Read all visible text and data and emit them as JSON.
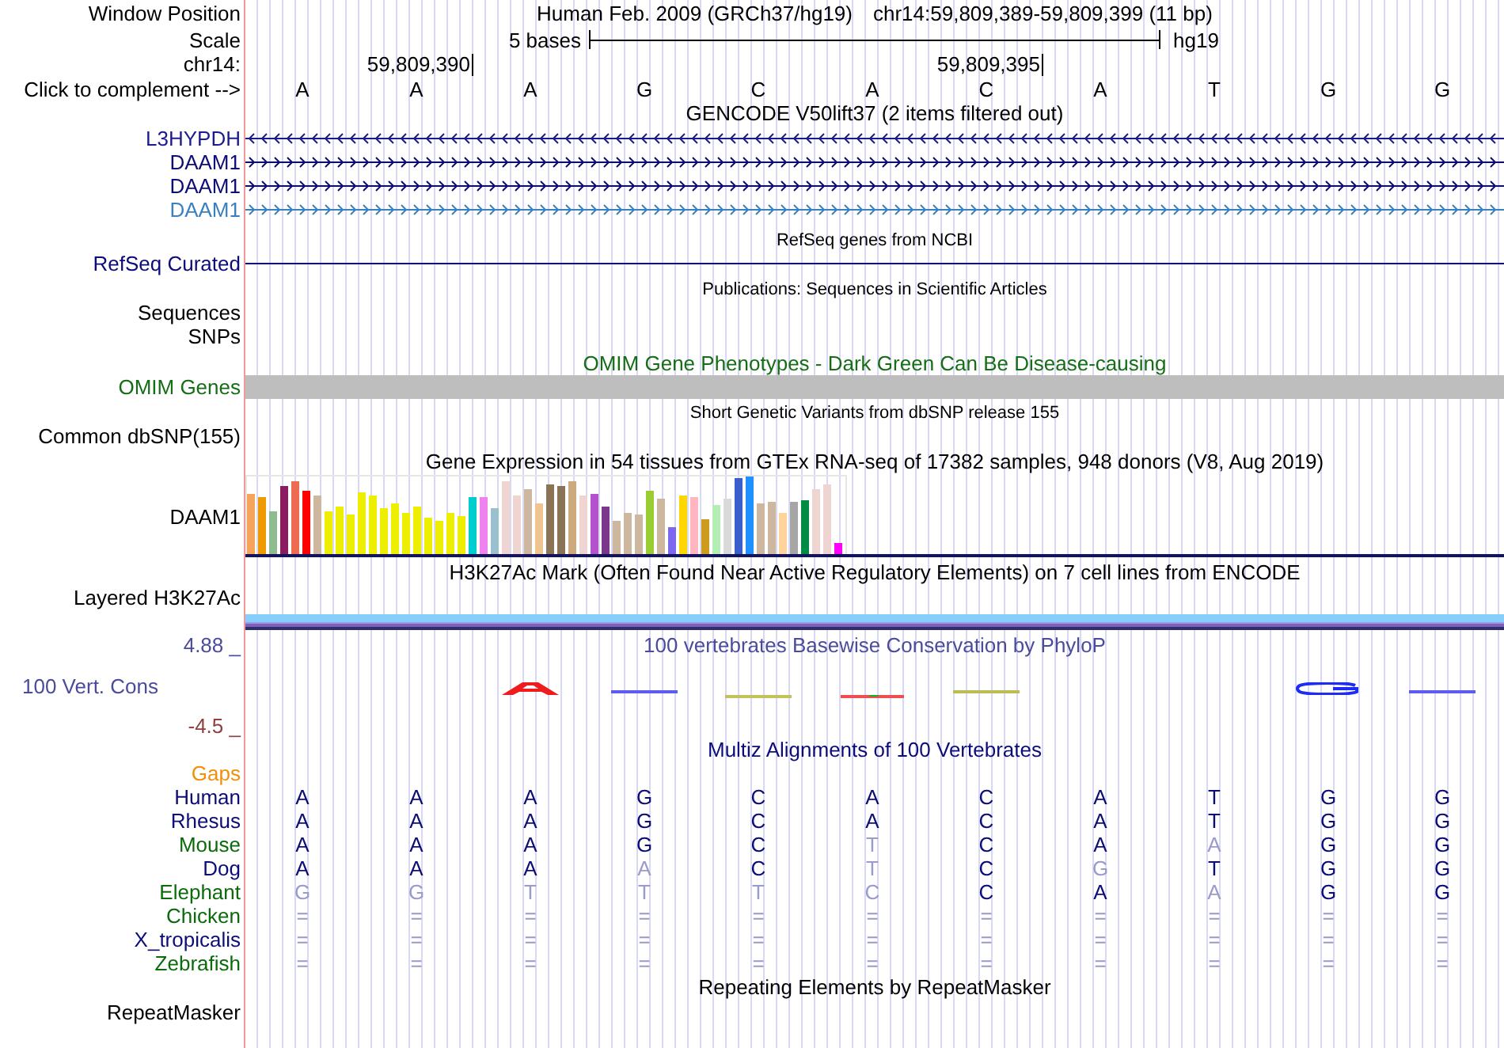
{
  "ruler": {
    "window_label": "Window Position",
    "assembly": "Human Feb. 2009 (GRCh37/hg19)",
    "position": "chr14:59,809,389-59,809,399 (11 bp)",
    "scale_label": "Scale",
    "scale_length": "5 bases",
    "scale_db": "hg19",
    "chrom_label": "chr14:",
    "complement_label": "Click to complement -->",
    "bases": [
      {
        "letter": "A"
      },
      {
        "letter": "A",
        "coordinate": "59,809,390"
      },
      {
        "letter": "A"
      },
      {
        "letter": "G"
      },
      {
        "letter": "C"
      },
      {
        "letter": "A"
      },
      {
        "letter": "C",
        "coordinate": "59,809,395"
      },
      {
        "letter": "A"
      },
      {
        "letter": "T"
      },
      {
        "letter": "G"
      },
      {
        "letter": "G"
      }
    ]
  },
  "tracks": [
    {
      "kind": "genes",
      "title": "GENCODE V50lift37 (2 items filtered out)",
      "color": "#000000",
      "items": [
        {
          "name": "L3HYPDH",
          "reverse_strand": true,
          "color": "#1b1b8f"
        },
        {
          "name": "DAAM1",
          "reverse_strand": false,
          "color": "#0c0c78"
        },
        {
          "name": "DAAM1",
          "reverse_strand": false,
          "color": "#0c0c78"
        },
        {
          "name": "DAAM1",
          "reverse_strand": false,
          "color": "#3a80c0"
        }
      ]
    },
    {
      "kind": "refseq",
      "title": "RefSeq genes from NCBI",
      "label": "RefSeq Curated",
      "color": "#0c0c78"
    },
    {
      "kind": "publications",
      "title": "Publications: Sequences in Scientific Articles",
      "labels": [
        "Sequences",
        "SNPs"
      ],
      "color": "#000000"
    },
    {
      "kind": "omim",
      "title": "OMIM Gene Phenotypes - Dark Green Can Be Disease-causing",
      "label": "OMIM Genes",
      "color": "#156e15"
    },
    {
      "kind": "variants",
      "title": "Short Genetic Variants from dbSNP release 155",
      "label": "Common dbSNP(155)",
      "color": "#000000"
    },
    {
      "kind": "expression",
      "title": "Gene Expression in 54 tissues from GTEx RNA-seq of 17382 samples, 948 donors (V8, Aug 2019)",
      "label": "DAAM1",
      "color": "#000000"
    },
    {
      "kind": "layered",
      "title": "H3K27Ac Mark (Often Found Near Active Regulatory Elements) on 7 cell lines from ENCODE",
      "label": "Layered H3K27Ac",
      "color": "#000000"
    },
    {
      "kind": "conservation",
      "title": "100 vertebrates Basewise Conservation by PhyloP",
      "label": "100 Vert. Cons",
      "max": "4.88 _",
      "min": "-4.5 _",
      "color": "#4b4b9b"
    },
    {
      "kind": "alignment",
      "title": "Multiz Alignments of 100 Vertebrates",
      "color": "#0c0c78",
      "rows": [
        {
          "name": "Gaps",
          "color": "#f0900a"
        },
        {
          "name": "Human",
          "color": "#0c0c78",
          "bases": [
            {
              "letter": "A",
              "match": true
            },
            {
              "letter": "A",
              "match": true
            },
            {
              "letter": "A",
              "match": true
            },
            {
              "letter": "G",
              "match": true
            },
            {
              "letter": "C",
              "match": true
            },
            {
              "letter": "A",
              "match": true
            },
            {
              "letter": "C",
              "match": true
            },
            {
              "letter": "A",
              "match": true
            },
            {
              "letter": "T",
              "match": true
            },
            {
              "letter": "G",
              "match": true
            },
            {
              "letter": "G",
              "match": true
            }
          ]
        },
        {
          "name": "Rhesus",
          "color": "#0c0c78",
          "bases": [
            {
              "letter": "A",
              "match": true
            },
            {
              "letter": "A",
              "match": true
            },
            {
              "letter": "A",
              "match": true
            },
            {
              "letter": "G",
              "match": true
            },
            {
              "letter": "C",
              "match": true
            },
            {
              "letter": "A",
              "match": true
            },
            {
              "letter": "C",
              "match": true
            },
            {
              "letter": "A",
              "match": true
            },
            {
              "letter": "T",
              "match": true
            },
            {
              "letter": "G",
              "match": true
            },
            {
              "letter": "G",
              "match": true
            }
          ]
        },
        {
          "name": "Mouse",
          "color": "#0b6b0b",
          "bases": [
            {
              "letter": "A",
              "match": true
            },
            {
              "letter": "A",
              "match": true
            },
            {
              "letter": "A",
              "match": true
            },
            {
              "letter": "G",
              "match": true
            },
            {
              "letter": "C",
              "match": true
            },
            {
              "letter": "T",
              "match": false
            },
            {
              "letter": "C",
              "match": true
            },
            {
              "letter": "A",
              "match": true
            },
            {
              "letter": "A",
              "match": false
            },
            {
              "letter": "G",
              "match": true
            },
            {
              "letter": "G",
              "match": true
            }
          ]
        },
        {
          "name": "Dog",
          "color": "#0c0c78",
          "bases": [
            {
              "letter": "A",
              "match": true
            },
            {
              "letter": "A",
              "match": true
            },
            {
              "letter": "A",
              "match": true
            },
            {
              "letter": "A",
              "match": false
            },
            {
              "letter": "C",
              "match": true
            },
            {
              "letter": "T",
              "match": false
            },
            {
              "letter": "C",
              "match": true
            },
            {
              "letter": "G",
              "match": false
            },
            {
              "letter": "T",
              "match": true
            },
            {
              "letter": "G",
              "match": true
            },
            {
              "letter": "G",
              "match": true
            }
          ]
        },
        {
          "name": "Elephant",
          "color": "#0b6b0b",
          "bases": [
            {
              "letter": "G",
              "match": false
            },
            {
              "letter": "G",
              "match": false
            },
            {
              "letter": "T",
              "match": false
            },
            {
              "letter": "T",
              "match": false
            },
            {
              "letter": "T",
              "match": false
            },
            {
              "letter": "C",
              "match": false
            },
            {
              "letter": "C",
              "match": true
            },
            {
              "letter": "A",
              "match": true
            },
            {
              "letter": "A",
              "match": false
            },
            {
              "letter": "G",
              "match": true
            },
            {
              "letter": "G",
              "match": true
            }
          ]
        },
        {
          "name": "Chicken",
          "color": "#0b6b0b",
          "bases": [
            {
              "letter": "=",
              "match": false
            },
            {
              "letter": "=",
              "match": false
            },
            {
              "letter": "=",
              "match": false
            },
            {
              "letter": "=",
              "match": false
            },
            {
              "letter": "=",
              "match": false
            },
            {
              "letter": "=",
              "match": false
            },
            {
              "letter": "=",
              "match": false
            },
            {
              "letter": "=",
              "match": false
            },
            {
              "letter": "=",
              "match": false
            },
            {
              "letter": "=",
              "match": false
            },
            {
              "letter": "=",
              "match": false
            }
          ]
        },
        {
          "name": "X_tropicalis",
          "color": "#0c0c78",
          "bases": [
            {
              "letter": "=",
              "match": false
            },
            {
              "letter": "=",
              "match": false
            },
            {
              "letter": "=",
              "match": false
            },
            {
              "letter": "=",
              "match": false
            },
            {
              "letter": "=",
              "match": false
            },
            {
              "letter": "=",
              "match": false
            },
            {
              "letter": "=",
              "match": false
            },
            {
              "letter": "=",
              "match": false
            },
            {
              "letter": "=",
              "match": false
            },
            {
              "letter": "=",
              "match": false
            },
            {
              "letter": "=",
              "match": false
            }
          ]
        },
        {
          "name": "Zebrafish",
          "color": "#0b6b0b",
          "bases": [
            {
              "letter": "=",
              "match": false
            },
            {
              "letter": "=",
              "match": false
            },
            {
              "letter": "=",
              "match": false
            },
            {
              "letter": "=",
              "match": false
            },
            {
              "letter": "=",
              "match": false
            },
            {
              "letter": "=",
              "match": false
            },
            {
              "letter": "=",
              "match": false
            },
            {
              "letter": "=",
              "match": false
            },
            {
              "letter": "=",
              "match": false
            },
            {
              "letter": "=",
              "match": false
            },
            {
              "letter": "=",
              "match": false
            }
          ]
        }
      ]
    },
    {
      "kind": "repeats",
      "title": "Repeating Elements by RepeatMasker",
      "label": "RepeatMasker",
      "color": "#000000"
    }
  ]
}
